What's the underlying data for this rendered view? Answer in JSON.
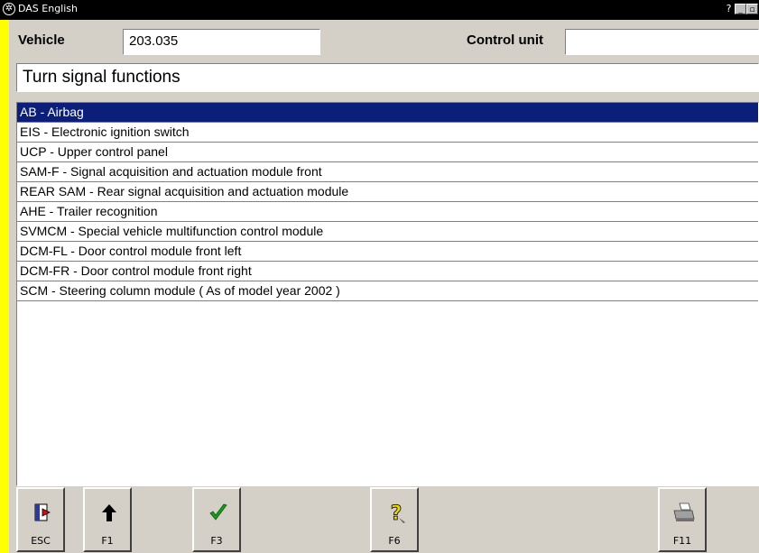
{
  "window": {
    "title": "DAS English",
    "help_glyph": "?",
    "min_glyph": "_",
    "max_glyph": "▫"
  },
  "header": {
    "vehicle_label": "Vehicle",
    "vehicle_value": "203.035",
    "control_unit_label": "Control unit",
    "control_unit_value": ""
  },
  "function_title": "Turn signal functions",
  "list": {
    "selected_index": 0,
    "items": [
      "AB - Airbag",
      "EIS - Electronic ignition switch",
      "UCP - Upper control panel",
      "SAM-F - Signal acquisition and actuation module front",
      "REAR SAM - Rear signal acquisition and actuation module",
      "AHE - Trailer recognition",
      "SVMCM - Special vehicle multifunction control module",
      "DCM-FL - Door control module front left",
      "DCM-FR - Door control module front right",
      "SCM - Steering column module ( As of model year 2002 )"
    ]
  },
  "toolbar": {
    "esc": {
      "label": "ESC",
      "icon": "exit-door-icon"
    },
    "f1": {
      "label": "F1",
      "icon": "arrow-up-icon"
    },
    "f3": {
      "label": "F3",
      "icon": "checkmark-icon"
    },
    "f6": {
      "label": "F6",
      "icon": "help-question-icon"
    },
    "f11": {
      "label": "F11",
      "icon": "printer-icon"
    }
  },
  "colors": {
    "background": "#ffff00",
    "panel": "#d4d0c8",
    "selection": "#0a1e7a",
    "check_green": "#1a9a1a",
    "help_yellow": "#e8d800"
  }
}
